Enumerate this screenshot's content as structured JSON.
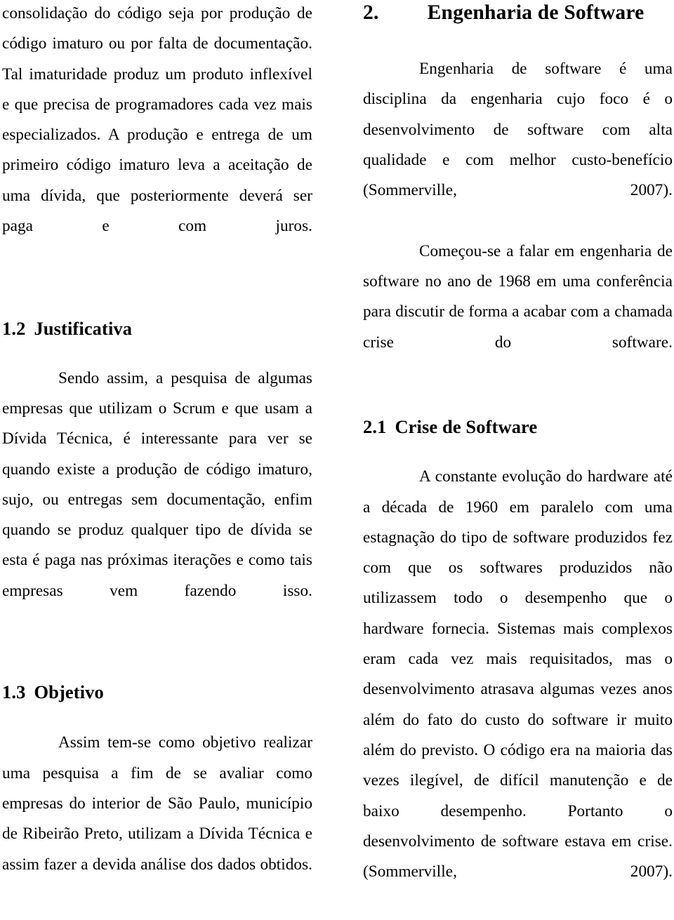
{
  "document": {
    "language": "pt-BR",
    "colors": {
      "page_background": "#ffffff",
      "text": "#000000"
    }
  },
  "left_column": {
    "continuation_paragraph": "consolidação do código seja por produção de código imaturo ou por falta de documentação. Tal imaturidade produz um produto inflexível e que precisa de programadores cada vez mais especializados. A produção e entrega de um primeiro código imaturo leva a aceitação de uma dívida, que posteriormente deverá ser paga e com juros.",
    "heading_justificativa": "1.2\tJustificativa",
    "paragraph_justificativa": "Sendo assim, a pesquisa de algumas empresas que utilizam o Scrum e que usam a Dívida Técnica, é interessante para ver se quando existe a produção de código imaturo, sujo, ou entregas sem documentação, enfim quando se produz qualquer tipo de dívida se esta é paga nas próximas iterações e como tais empresas vem fazendo isso.",
    "heading_objetivo": "1.3\tObjetivo",
    "paragraph_objetivo": "Assim tem-se como objetivo realizar uma pesquisa a fim de se avaliar como empresas do interior de São Paulo, município de Ribeirão Preto, utilizam a Dívida Técnica e assim fazer a devida análise dos dados obtidos."
  },
  "right_column": {
    "heading_chapter": "2.\t  Engenharia de Software",
    "paragraph_definition": "Engenharia de software é uma disciplina da engenharia cujo foco é o desenvolvimento de software com alta qualidade e com melhor custo-benefício (Sommerville, 2007).",
    "paragraph_history": "Começou-se a falar em engenharia de software no ano de 1968 em uma conferência para discutir de forma a acabar com a chamada crise do software.",
    "heading_crise": "2.1\tCrise de Software",
    "paragraph_crise": "A constante evolução do hardware até a década de 1960 em paralelo com uma estagnação do tipo de software produzidos fez com que os softwares produzidos não utilizassem todo o desempenho que o hardware fornecia. Sistemas mais complexos eram cada vez mais requisitados, mas o desenvolvimento atrasava algumas vezes anos além do fato do custo do software ir muito além do previsto. O código era na maioria das vezes ilegível, de difícil manutenção e de baixo desempenho. Portanto o desenvolvimento de software estava em crise. (Sommerville, 2007)."
  }
}
